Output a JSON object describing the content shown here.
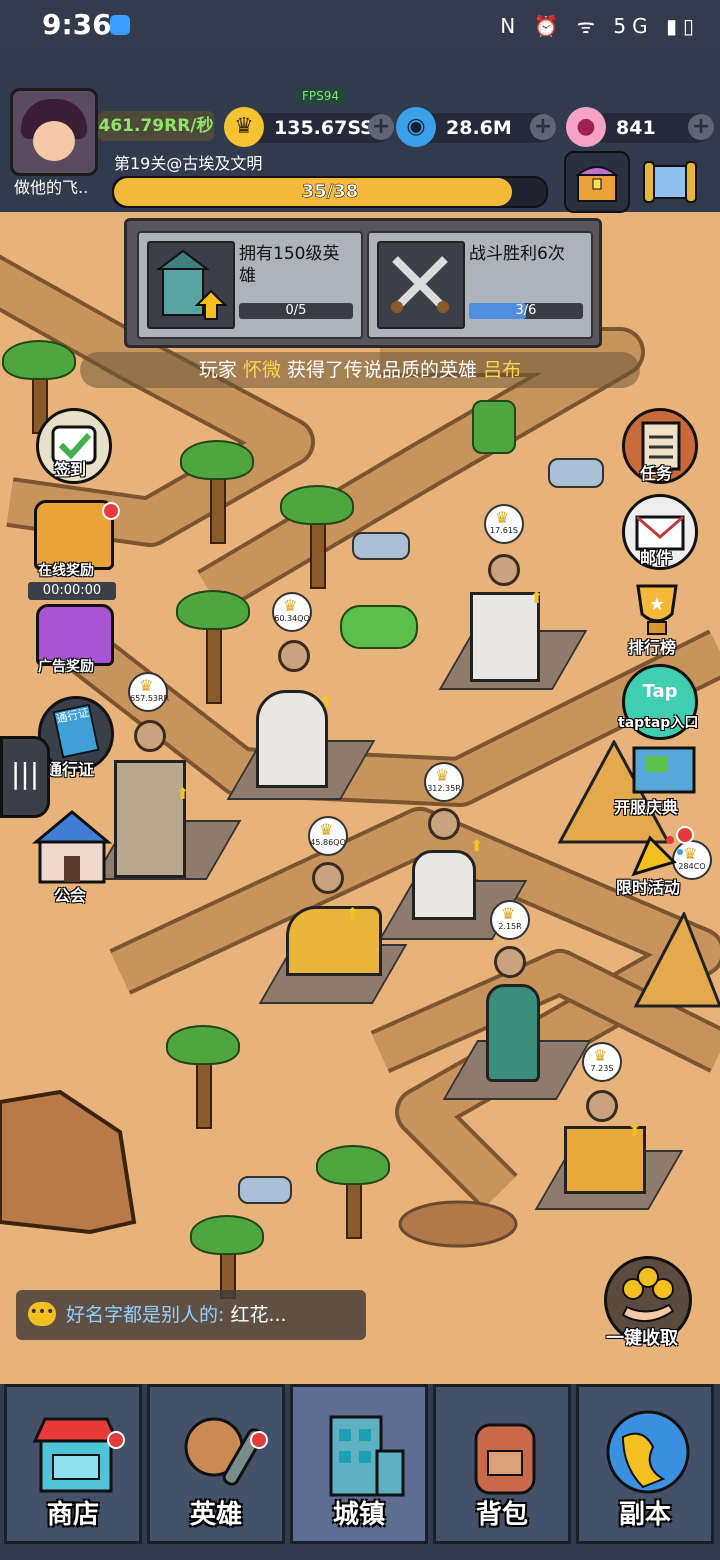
{
  "status_bar": {
    "time": "9:36",
    "icons": "N ⏰ ᯤ 5G ▮▯"
  },
  "player": {
    "nickname": "做他的飞..",
    "income_rate": "461.79RR/秒"
  },
  "fps": "FPS94",
  "resources": [
    {
      "icon": "crown-icon",
      "value": "135.67SS"
    },
    {
      "icon": "blue-gem-icon",
      "value": "28.6M"
    },
    {
      "icon": "pink-candy-icon",
      "value": "841"
    }
  ],
  "stage": {
    "label": "第19关@古埃及文明",
    "progress_text": "35/38",
    "progress_fraction": 0.921
  },
  "quests": [
    {
      "icon": "house-upgrade-icon",
      "text": "拥有150级英雄",
      "progress_text": "0/5",
      "progress_fraction": 0.0
    },
    {
      "icon": "crossed-swords-icon",
      "text": "战斗胜利6次",
      "progress_text": "3/6",
      "progress_fraction": 0.5
    }
  ],
  "announcement": {
    "prefix": "玩家 ",
    "player": "怀微",
    "middle": " 获得了传说品质的英雄 ",
    "hero": "吕布"
  },
  "left_buttons": [
    {
      "name": "sign-in",
      "label": "签到"
    },
    {
      "name": "online-reward",
      "label": "在线奖励",
      "timer": "00:00:00"
    },
    {
      "name": "ad-reward",
      "label": "广告奖励"
    },
    {
      "name": "pass",
      "label": "通行证",
      "badge": "通行证"
    },
    {
      "name": "guild",
      "label": "公会"
    }
  ],
  "right_buttons": [
    {
      "name": "tasks",
      "label": "任务"
    },
    {
      "name": "mail",
      "label": "邮件"
    },
    {
      "name": "leaderboard",
      "label": "排行榜"
    },
    {
      "name": "taptap",
      "label": "taptap入口",
      "logo": "Tap"
    },
    {
      "name": "server-celebration",
      "label": "开服庆典"
    },
    {
      "name": "limited-event",
      "label": "限时活动"
    },
    {
      "name": "collect-all",
      "label": "一键收取"
    }
  ],
  "building_values": [
    "17.61S",
    "60.34QQ",
    "657.53RR",
    "312.35R",
    "45.86QQ",
    "2.15R",
    "284CO",
    "7.23S"
  ],
  "chat": {
    "sender": "好名字都是别人的:",
    "message": " 红花..."
  },
  "nav": [
    {
      "label": "商店",
      "icon": "shop-icon"
    },
    {
      "label": "英雄",
      "icon": "hero-icon"
    },
    {
      "label": "城镇",
      "icon": "town-icon",
      "active": true
    },
    {
      "label": "背包",
      "icon": "backpack-icon"
    },
    {
      "label": "副本",
      "icon": "globe-icon"
    }
  ]
}
